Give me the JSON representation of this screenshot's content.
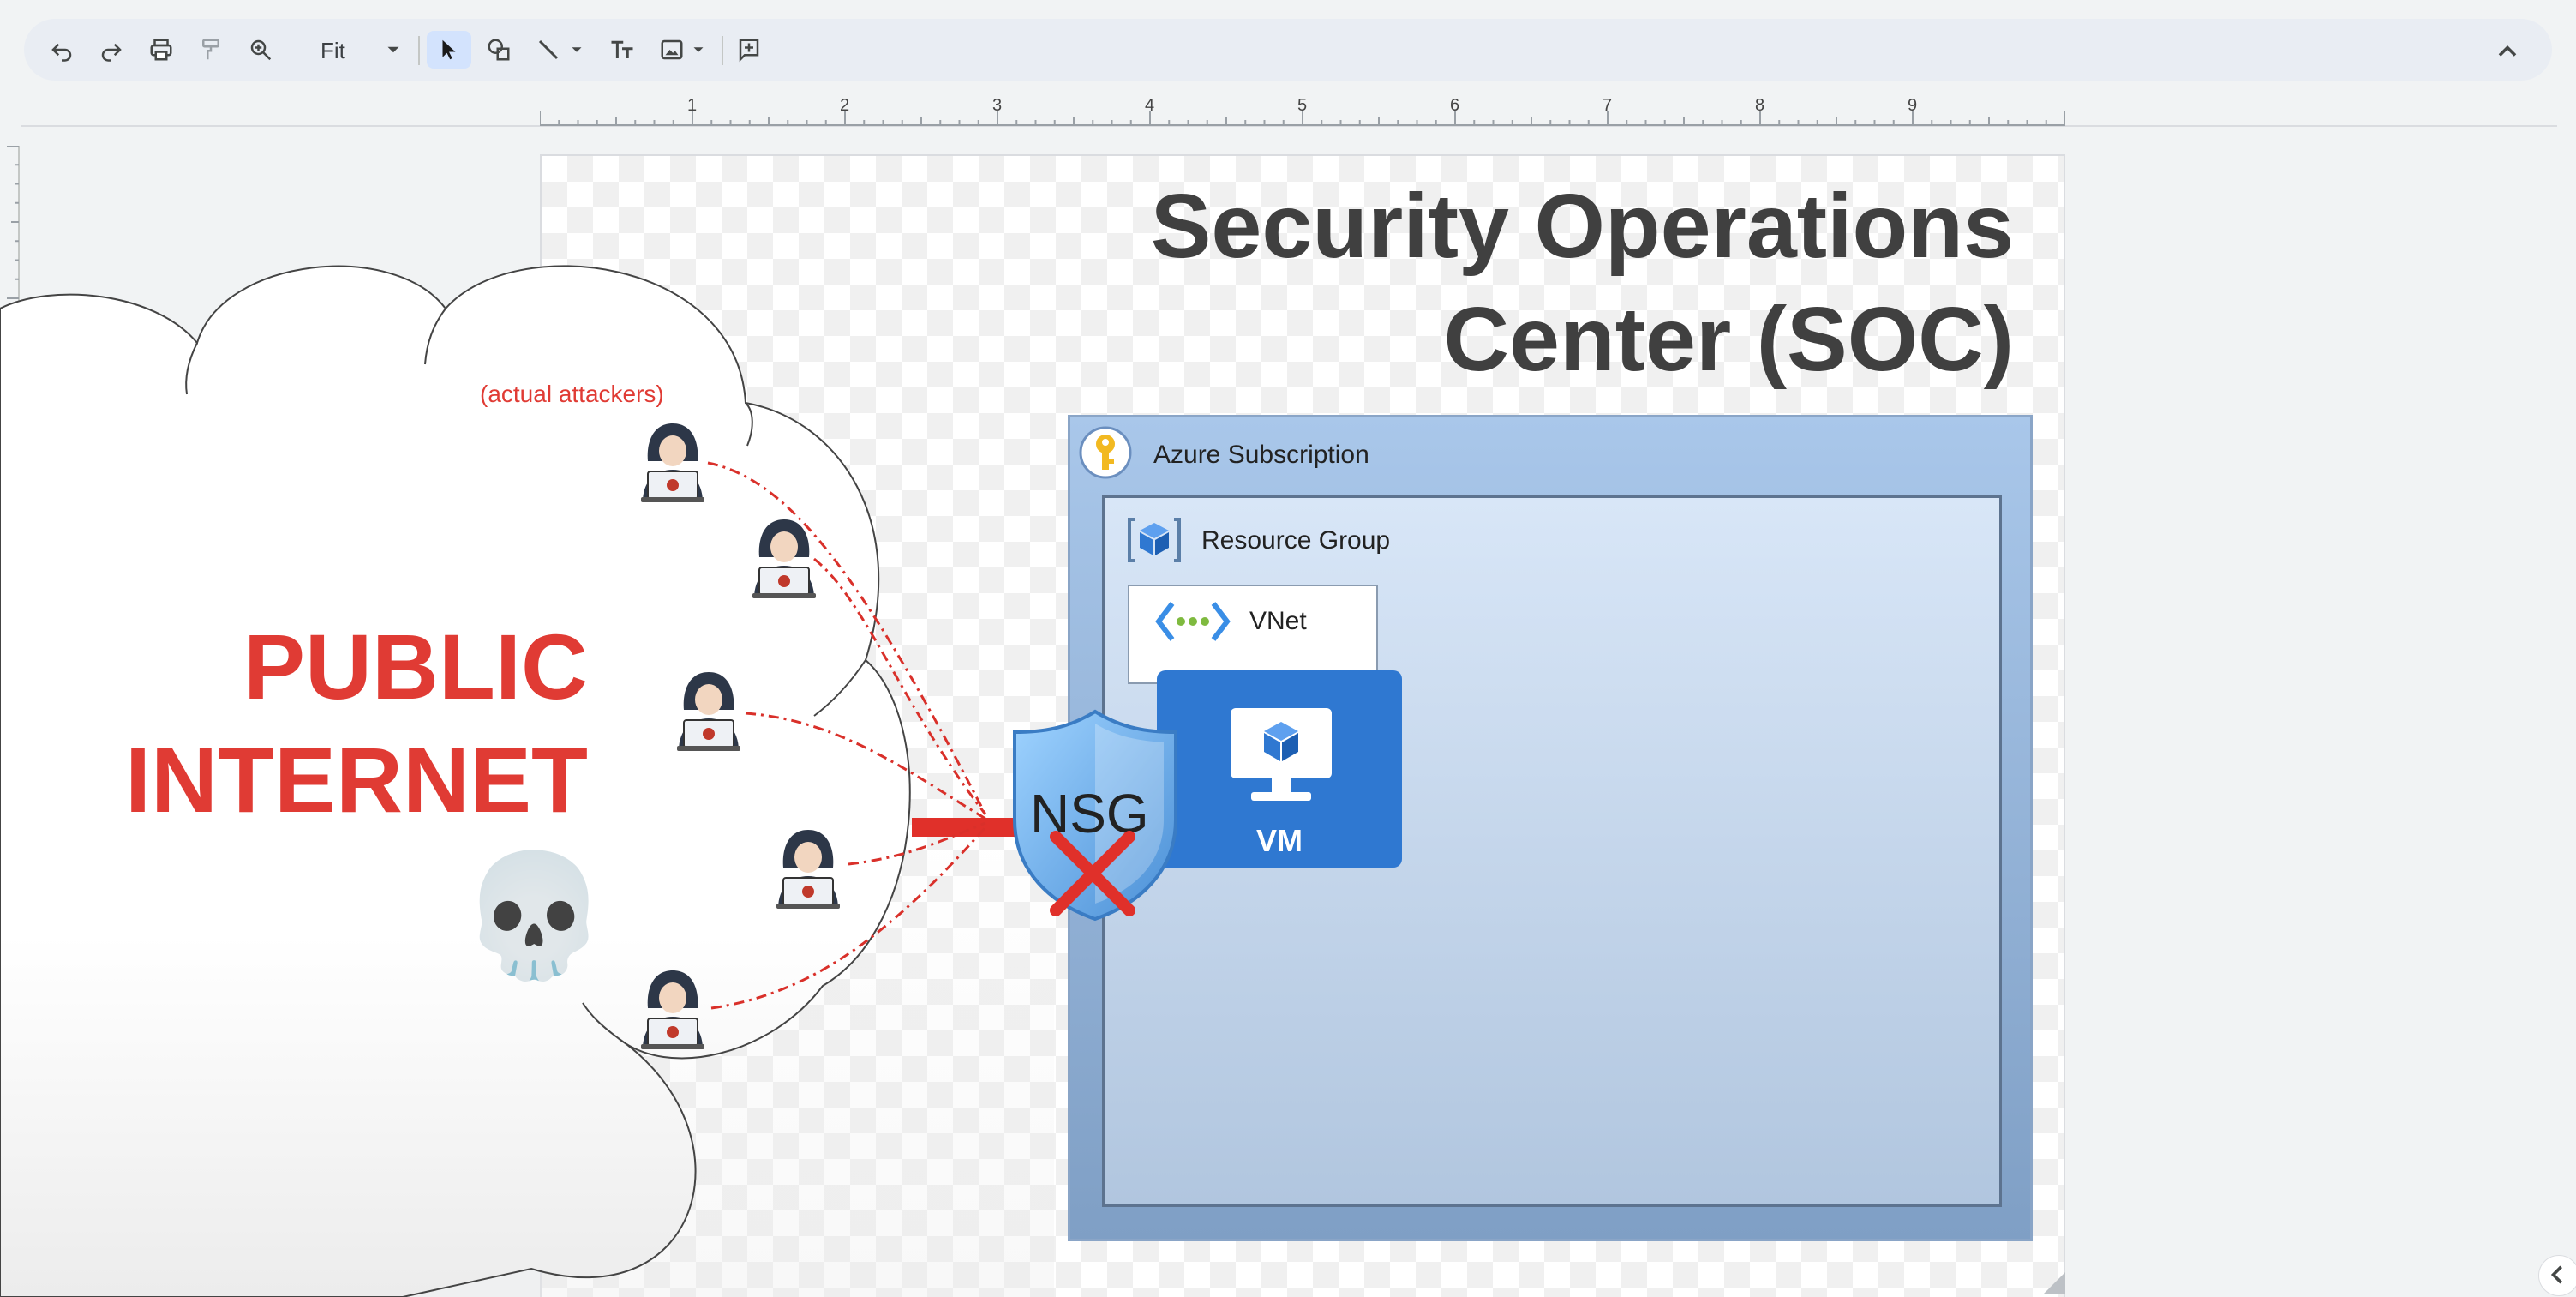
{
  "toolbar": {
    "zoom_value": "Fit",
    "buttons": [
      "undo-icon",
      "redo-icon",
      "print-icon",
      "paint-format-icon",
      "zoom-icon",
      "select-icon",
      "shape-icon",
      "line-icon",
      "text-box-icon",
      "image-icon",
      "comment-icon"
    ]
  },
  "ruler": {
    "ticks": [
      "1",
      "2",
      "3",
      "4",
      "5",
      "6",
      "7",
      "8",
      "9"
    ]
  },
  "diagram": {
    "title_line1": "Security Operations",
    "title_line2": "Center (SOC)",
    "public_line1": "PUBLIC",
    "public_line2": "INTERNET",
    "attackers_label": "(actual attackers)",
    "subscription_label": "Azure Subscription",
    "resource_group_label": "Resource Group",
    "vnet_label": "VNet",
    "vm_label": "VM",
    "nsg_label": "NSG",
    "skull": "💀"
  },
  "colors": {
    "accent_red": "#e03b34",
    "azure_blue": "#2f78d1",
    "subscription_fill": "#a9c7ea"
  }
}
